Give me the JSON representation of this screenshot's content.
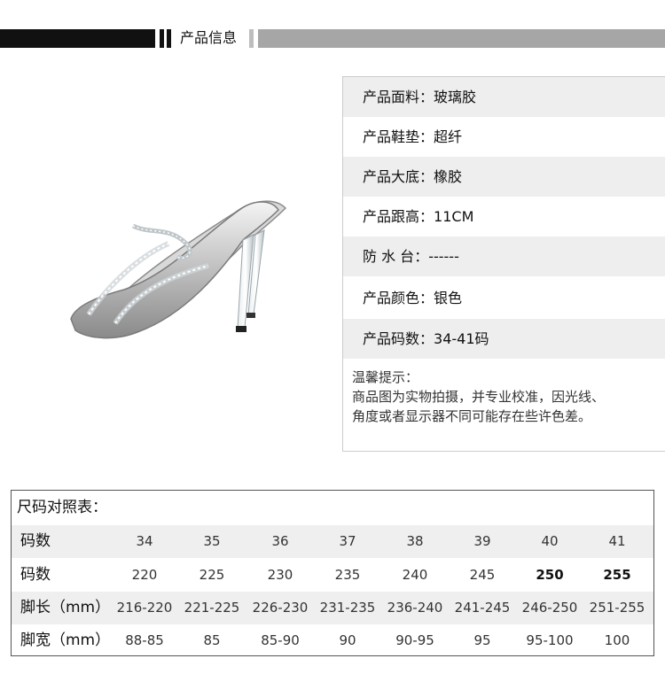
{
  "header": {
    "title": "产品信息"
  },
  "product_image": {
    "alt_icon": "silver-rhinestone-heel-sandal-image"
  },
  "info": {
    "rows": [
      {
        "label": "产品面料",
        "value": "玻璃胶"
      },
      {
        "label": "产品鞋垫",
        "value": "超纤"
      },
      {
        "label": "产品大底",
        "value": "橡胶"
      },
      {
        "label": "产品跟高",
        "value": "11CM"
      },
      {
        "label": "防 水 台",
        "value": "------"
      },
      {
        "label": "产品颜色",
        "value": "银色"
      },
      {
        "label": "产品码数",
        "value": "34-41码"
      }
    ],
    "colon": "：",
    "tips_title": "温馨提示：",
    "tips_line1": "商品图为实物拍摄，并专业校准，因光线、",
    "tips_line2": "角度或者显示器不同可能存在些许色差。"
  },
  "size_table": {
    "title": "尺码对照表：",
    "rows": [
      {
        "label": "码数",
        "cells": [
          "34",
          "35",
          "36",
          "37",
          "38",
          "39",
          "40",
          "41"
        ]
      },
      {
        "label": "码数",
        "cells": [
          "220",
          "225",
          "230",
          "235",
          "240",
          "245",
          "250",
          "255"
        ]
      },
      {
        "label": "脚长（mm）",
        "cells": [
          "216-220",
          "221-225",
          "226-230",
          "231-235",
          "236-240",
          "241-245",
          "246-250",
          "251-255"
        ]
      },
      {
        "label": "脚宽（mm）",
        "cells": [
          "88-85",
          "85",
          "85-90",
          "90",
          "90-95",
          "95",
          "95-100",
          "100"
        ]
      }
    ]
  },
  "colors": {
    "header_dark": "#111111",
    "header_gray": "#a6a6a6",
    "row_alt": "#eeeeee"
  }
}
